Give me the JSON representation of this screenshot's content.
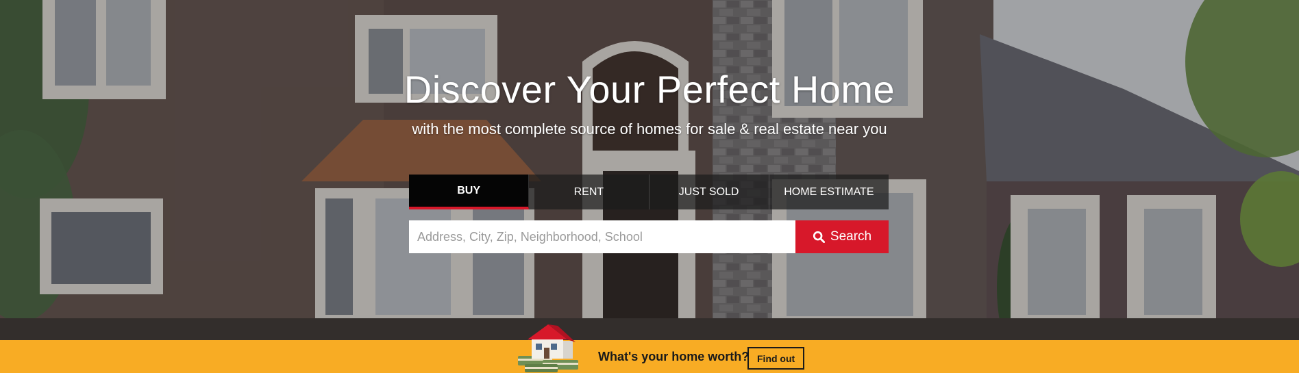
{
  "hero": {
    "title": "Discover Your Perfect Home",
    "subtitle": "with the most complete source of homes for sale & real estate near you"
  },
  "search_tabs": [
    {
      "label": "BUY",
      "active": true
    },
    {
      "label": "RENT",
      "active": false
    },
    {
      "label": "JUST SOLD",
      "active": false
    },
    {
      "label": "HOME ESTIMATE",
      "active": false
    }
  ],
  "search": {
    "placeholder": "Address, City, Zip, Neighborhood, School",
    "value": "",
    "button_label": "Search",
    "button_icon": "search-icon"
  },
  "banner": {
    "question": "What's your home worth?",
    "button_label": "Find out",
    "icon": "house-with-money-icon"
  },
  "colors": {
    "accent_red": "#d7182a",
    "banner_yellow": "#f8ac24",
    "tab_active_bg": "#050505"
  }
}
